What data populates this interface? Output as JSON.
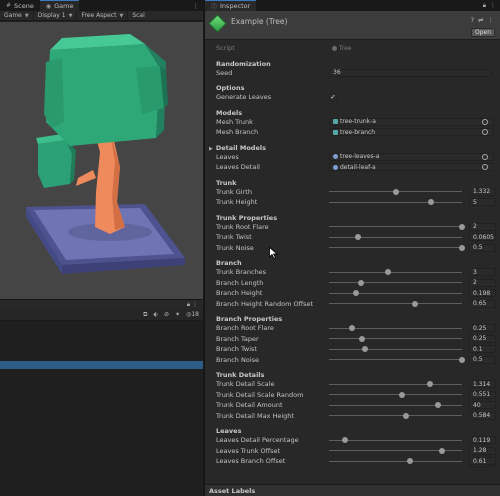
{
  "scene_window": {
    "tabs": [
      {
        "label": "Scene",
        "icon": "scene-icon"
      },
      {
        "label": "Game",
        "icon": "gamepad-icon"
      }
    ],
    "toolbar": {
      "view_mode": "Game",
      "display": "Display 1",
      "aspect": "Free Aspect",
      "scale_label": "Scal"
    }
  },
  "bottom_panel": {
    "tools_count": "18"
  },
  "inspector": {
    "tab_label": "Inspector",
    "object_title": "Example (Tree)",
    "open_button": "Open",
    "script": {
      "label": "Script",
      "value": "Tree"
    },
    "sections": {
      "randomization": "Randomization",
      "options": "Options",
      "models": "Models",
      "detail_models": "Detail Models",
      "trunk": "Trunk",
      "trunk_properties": "Trunk Properties",
      "branch": "Branch",
      "branch_properties": "Branch Properties",
      "trunk_details": "Trunk Details",
      "leaves": "Leaves",
      "asset_labels": "Asset Labels"
    },
    "seed": {
      "label": "Seed",
      "value": "36"
    },
    "generate_leaves": {
      "label": "Generate Leaves",
      "checked": true,
      "mark": "✓"
    },
    "mesh_trunk": {
      "label": "Mesh Trunk",
      "value": "tree-trunk-a"
    },
    "mesh_branch": {
      "label": "Mesh Branch",
      "value": "tree-branch"
    },
    "detail_models_count": "1",
    "leaves_field": {
      "label": "Leaves",
      "value": "tree-leaves-a"
    },
    "leaves_detail": {
      "label": "Leaves Detail",
      "value": "detail-leaf-a"
    },
    "sliders": {
      "trunk_girth": {
        "label": "Trunk Girth",
        "value": "1.332",
        "fraction": 0.5
      },
      "trunk_height": {
        "label": "Trunk Height",
        "value": "5",
        "fraction": 0.77
      },
      "trunk_root_flare": {
        "label": "Trunk Root Flare",
        "value": "2",
        "fraction": 1.0
      },
      "trunk_twist": {
        "label": "Trunk Twist",
        "value": "0.0605",
        "fraction": 0.22
      },
      "trunk_noise": {
        "label": "Trunk Noise",
        "value": "0.5",
        "fraction": 1.0
      },
      "trunk_branches": {
        "label": "Trunk Branches",
        "value": "3",
        "fraction": 0.44
      },
      "branch_length": {
        "label": "Branch Length",
        "value": "2",
        "fraction": 0.24
      },
      "branch_height": {
        "label": "Branch Height",
        "value": "0.198",
        "fraction": 0.2
      },
      "branch_height_random_offset": {
        "label": "Branch Height Random Offset",
        "value": "0.65",
        "fraction": 0.65
      },
      "branch_root_flare": {
        "label": "Branch Root Flare",
        "value": "0.25",
        "fraction": 0.17
      },
      "branch_taper": {
        "label": "Branch Taper",
        "value": "0.25",
        "fraction": 0.25
      },
      "branch_twist": {
        "label": "Branch Twist",
        "value": "0.1",
        "fraction": 0.27
      },
      "branch_noise": {
        "label": "Branch Noise",
        "value": "0.5",
        "fraction": 1.0
      },
      "trunk_detail_scale": {
        "label": "Trunk Detail Scale",
        "value": "1.314",
        "fraction": 0.76
      },
      "trunk_detail_scale_random": {
        "label": "Trunk Detail Scale Random",
        "value": "0.551",
        "fraction": 0.55
      },
      "trunk_detail_amount": {
        "label": "Trunk Detail Amount",
        "value": "40",
        "fraction": 0.82
      },
      "trunk_detail_max_height": {
        "label": "Trunk Detail Max Height",
        "value": "0.584",
        "fraction": 0.58
      },
      "leaves_detail_percentage": {
        "label": "Leaves Detail Percentage",
        "value": "0.119",
        "fraction": 0.12
      },
      "leaves_trunk_offset": {
        "label": "Leaves Trunk Offset",
        "value": "1.28",
        "fraction": 0.85
      },
      "leaves_branch_offset": {
        "label": "Leaves Branch Offset",
        "value": "0.61",
        "fraction": 0.61
      }
    }
  },
  "colors": {
    "accent_tab": "#3a79bb",
    "tree_canopy": "#2fa877",
    "tree_trunk": "#f08a5d",
    "base_platform": "#6a6fae",
    "selection": "#2c5d87"
  }
}
